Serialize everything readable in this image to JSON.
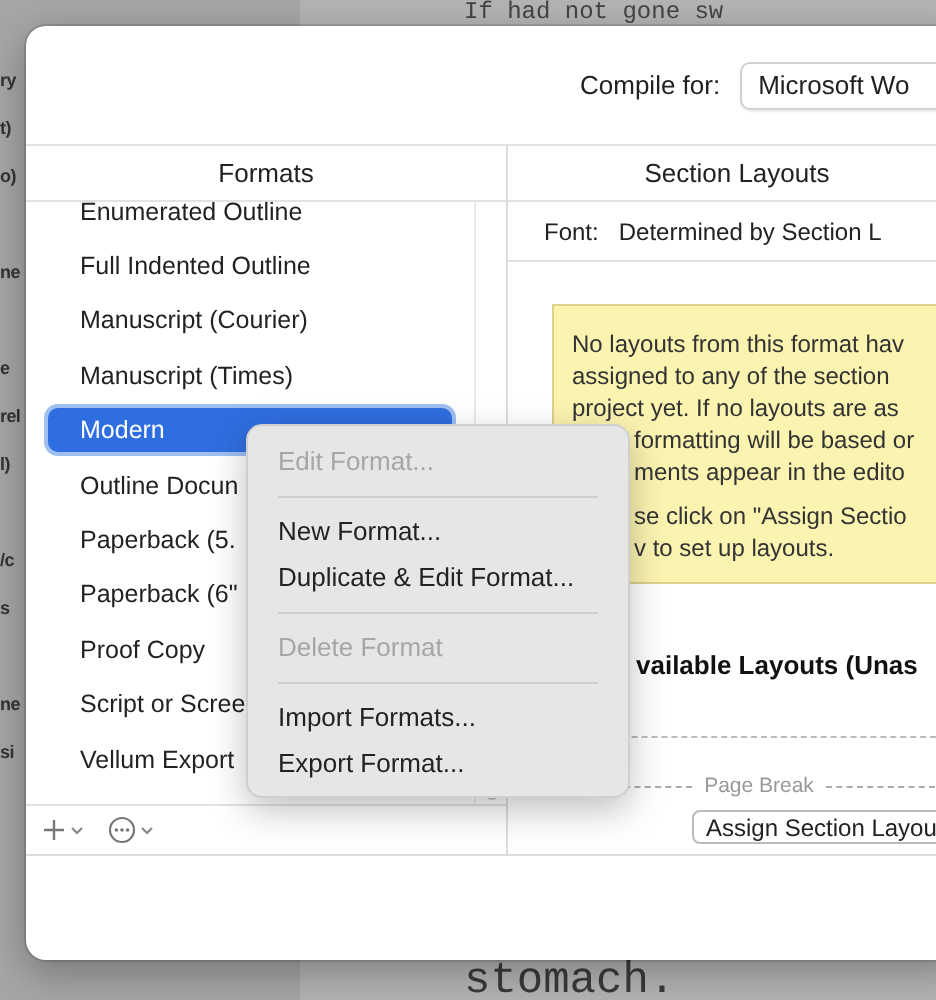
{
  "background": {
    "top_text": "If had not gone sw",
    "bottom_text": "stomach.",
    "side_fragments": [
      [
        "ry",
        "t)",
        "o)"
      ],
      [
        "ne"
      ],
      [
        "e",
        "rel",
        "l)"
      ],
      [
        "/c",
        "s"
      ],
      [
        "ne",
        "si"
      ]
    ]
  },
  "compile_for": {
    "label": "Compile for:",
    "value": "Microsoft Wo"
  },
  "formats": {
    "title": "Formats",
    "items": [
      {
        "label": "Enumerated Outline",
        "selected": false
      },
      {
        "label": "Full Indented Outline",
        "selected": false
      },
      {
        "label": "Manuscript (Courier)",
        "selected": false
      },
      {
        "label": "Manuscript (Times)",
        "selected": false
      },
      {
        "label": "Modern",
        "selected": true
      },
      {
        "label": "Outline Docun",
        "selected": false
      },
      {
        "label": "Paperback (5.",
        "selected": false
      },
      {
        "label": "Paperback (6\"",
        "selected": false
      },
      {
        "label": "Proof Copy",
        "selected": false
      },
      {
        "label": "Script or Scree",
        "selected": false
      },
      {
        "label": "Vellum Export",
        "selected": false
      }
    ]
  },
  "section_layouts": {
    "title": "Section Layouts",
    "font_label": "Font:",
    "font_value": "Determined by Section L",
    "note": [
      [
        {
          "kind": "line",
          "text": "No layouts from this format hav"
        },
        {
          "kind": "line",
          "text": "assigned to any of the section"
        },
        {
          "kind": "line",
          "text": "project yet. If no layouts are as"
        },
        {
          "kind": "covered",
          "text": "formatting will be based or"
        },
        {
          "kind": "covered",
          "text": "ments appear in the edito"
        }
      ],
      [
        {
          "kind": "covered",
          "text": "se click on \"Assign Sectio"
        },
        {
          "kind": "covered",
          "text": "v to set up layouts."
        }
      ]
    ],
    "available_heading": "vailable Layouts (Unas",
    "page_break": "Page Break",
    "assign_button": "Assign Section Layou"
  },
  "context_menu": [
    {
      "kind": "item",
      "label": "Edit Format...",
      "disabled": true
    },
    {
      "kind": "separator"
    },
    {
      "kind": "item",
      "label": "New Format...",
      "disabled": false
    },
    {
      "kind": "item",
      "label": "Duplicate & Edit Format...",
      "disabled": false
    },
    {
      "kind": "separator"
    },
    {
      "kind": "item",
      "label": "Delete Format",
      "disabled": true
    },
    {
      "kind": "separator"
    },
    {
      "kind": "item",
      "label": "Import Formats...",
      "disabled": false
    },
    {
      "kind": "item",
      "label": "Export Format...",
      "disabled": false
    }
  ]
}
